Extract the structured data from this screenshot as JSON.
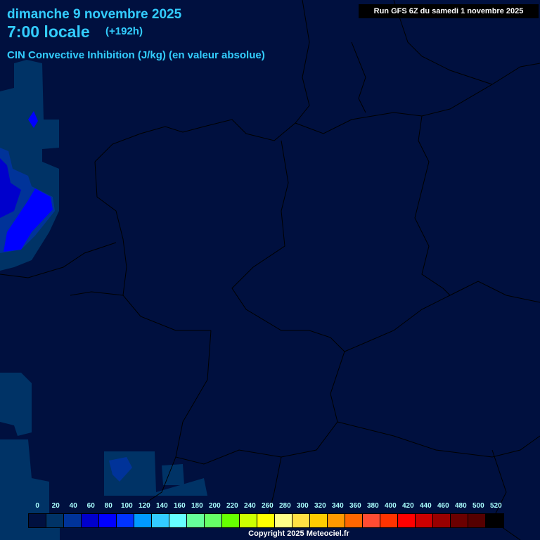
{
  "header": {
    "date": "dimanche 9 novembre 2025",
    "local_time": "7:00 locale",
    "lead_time": "(+192h)",
    "parameter": "CIN Convective Inhibition (J/kg) (en valeur absolue)",
    "run": "Run GFS 6Z du samedi 1 novembre 2025"
  },
  "legend": {
    "labels": [
      "0",
      "20",
      "40",
      "60",
      "80",
      "100",
      "120",
      "140",
      "160",
      "180",
      "200",
      "220",
      "240",
      "260",
      "280",
      "300",
      "320",
      "340",
      "360",
      "380",
      "400",
      "420",
      "440",
      "460",
      "480",
      "500",
      "520"
    ],
    "colors": [
      "#00103f",
      "#003366",
      "#003399",
      "#0000cc",
      "#0000ff",
      "#0033ff",
      "#0099ff",
      "#33ccff",
      "#66ffff",
      "#66ff99",
      "#66ff66",
      "#66ff00",
      "#ccff00",
      "#ffff00",
      "#ffff88",
      "#ffe044",
      "#ffcc00",
      "#ff9900",
      "#ff6600",
      "#ff4c33",
      "#ff3300",
      "#ff0000",
      "#cc0000",
      "#990000",
      "#6b0000",
      "#550000",
      "#000000"
    ]
  },
  "footer": {
    "copyright": "Copyright 2025 Meteociel.fr"
  }
}
